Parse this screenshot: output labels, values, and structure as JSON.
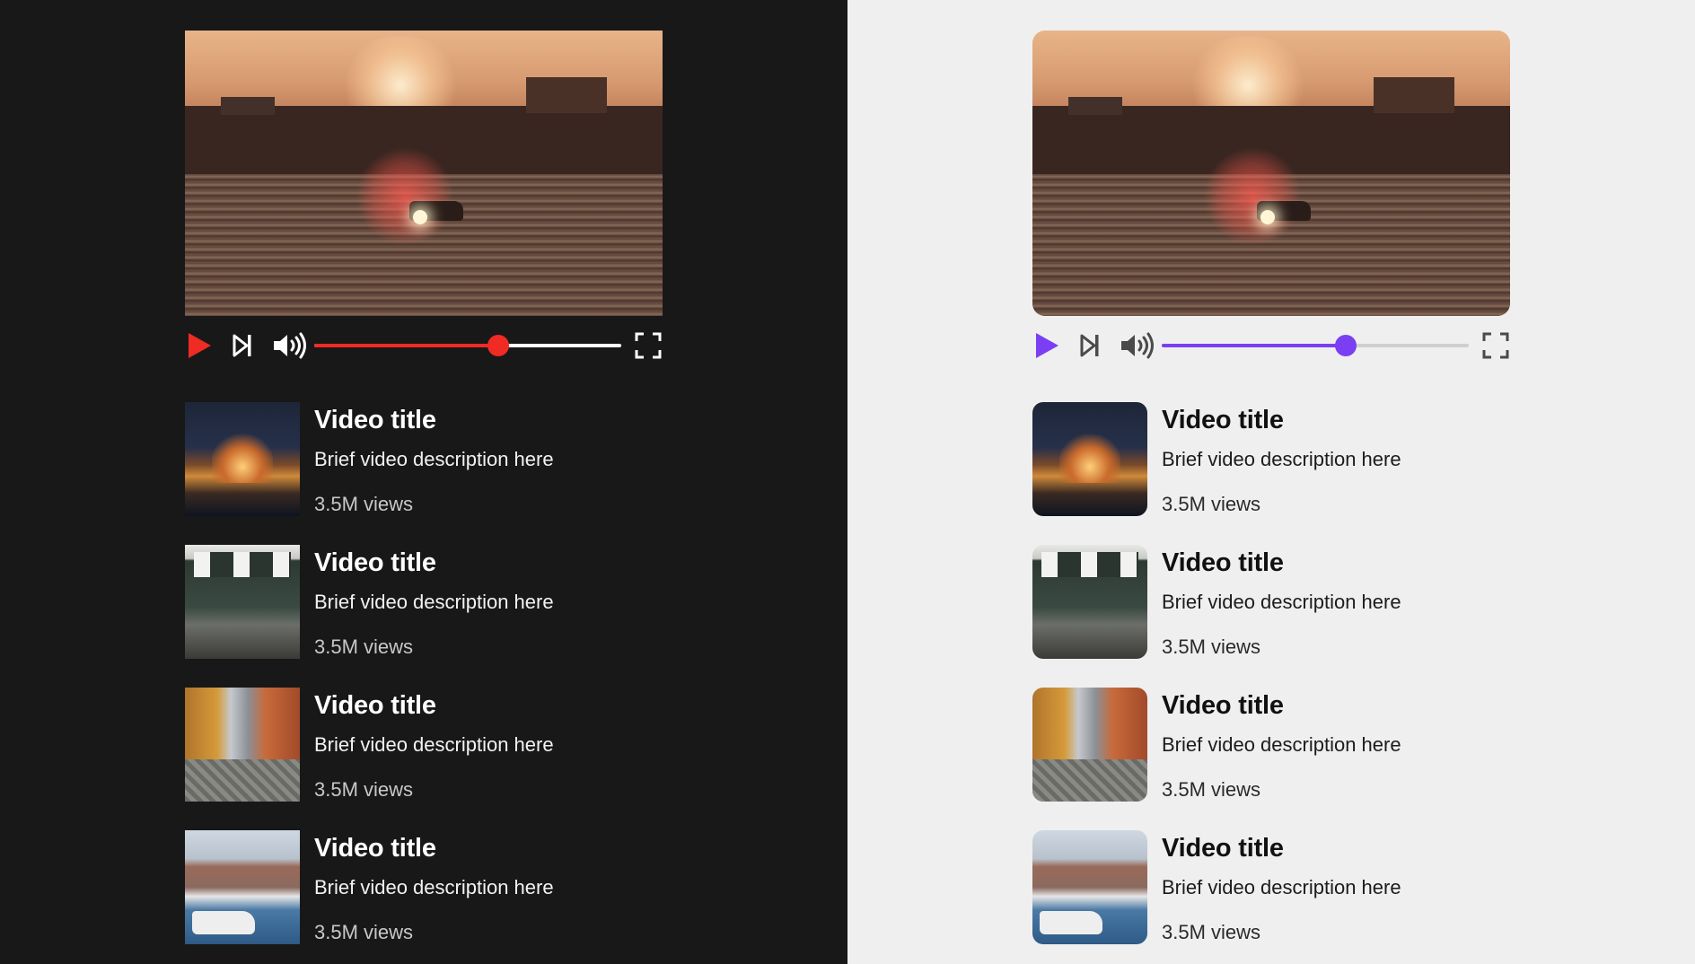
{
  "themes": {
    "dark": {
      "background": "#181818",
      "accent": "#ef2b24",
      "icon_color": "#ffffff"
    },
    "light": {
      "background": "#efefef",
      "accent": "#7a3ff2",
      "icon_color": "#4a4a4a"
    }
  },
  "player": {
    "progress": 0.6,
    "icons": [
      "play-icon",
      "skip-next-icon",
      "volume-icon",
      "fullscreen-icon"
    ]
  },
  "videos": [
    {
      "title": "Video title",
      "description": "Brief video description here",
      "views": "3.5M views"
    },
    {
      "title": "Video title",
      "description": "Brief video description here",
      "views": "3.5M views"
    },
    {
      "title": "Video title",
      "description": "Brief video description here",
      "views": "3.5M views"
    },
    {
      "title": "Video title",
      "description": "Brief video description here",
      "views": "3.5M views"
    }
  ]
}
